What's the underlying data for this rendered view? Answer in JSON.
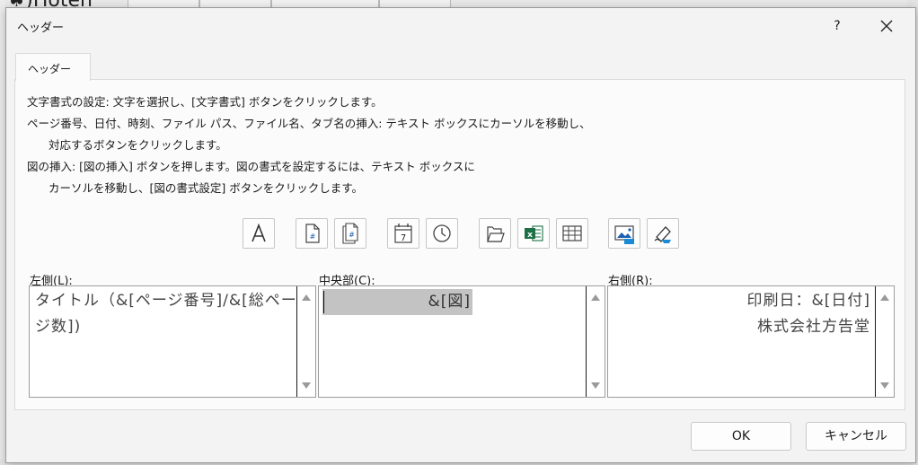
{
  "background": {
    "app_title": "(♠)Hoten"
  },
  "dialog": {
    "title": "ヘッダー",
    "help_label": "?",
    "tab_label": "ヘッダー",
    "instructions": [
      "文字書式の設定: 文字を選択し、[文字書式] ボタンをクリックします。",
      "ページ番号、日付、時刻、ファイル パス、ファイル名、タブ名の挿入: テキスト ボックスにカーソルを移動し、",
      "対応するボタンをクリックします。",
      "図の挿入: [図の挿入] ボタンを押します。図の書式を設定するには、テキスト ボックスに",
      "カーソルを移動し、[図の書式設定] ボタンをクリックします。"
    ],
    "toolbar": [
      {
        "icon": "format-text-icon"
      },
      {
        "icon": "insert-page-number-icon"
      },
      {
        "icon": "insert-number-of-pages-icon"
      },
      {
        "icon": "insert-date-icon",
        "text": "7"
      },
      {
        "icon": "insert-time-icon"
      },
      {
        "icon": "insert-file-path-icon"
      },
      {
        "icon": "insert-file-name-icon"
      },
      {
        "icon": "insert-sheet-name-icon"
      },
      {
        "icon": "insert-picture-icon"
      },
      {
        "icon": "format-picture-icon"
      }
    ],
    "sections": {
      "left": {
        "label_prefix": "左側(",
        "accel": "L",
        "label_suffix": "):",
        "lines": [
          "タイトル（&[ページ番号]/&[総ペー",
          "ジ数])"
        ]
      },
      "center": {
        "label_prefix": "中央部(",
        "accel": "C",
        "label_suffix": "):",
        "selected_text": "&[図]"
      },
      "right": {
        "label_prefix": "右側(",
        "accel": "R",
        "label_suffix": "):",
        "lines": [
          "印刷日：&[日付]",
          "株式会社方告堂"
        ]
      }
    },
    "buttons": {
      "ok": "OK",
      "cancel": "キャンセル"
    },
    "colors": {
      "dialog_bg": "#f3f3f3",
      "panel_bg": "#fbfbfb",
      "selection": "#c3c3c3",
      "excel_green": "#1d7044"
    }
  }
}
